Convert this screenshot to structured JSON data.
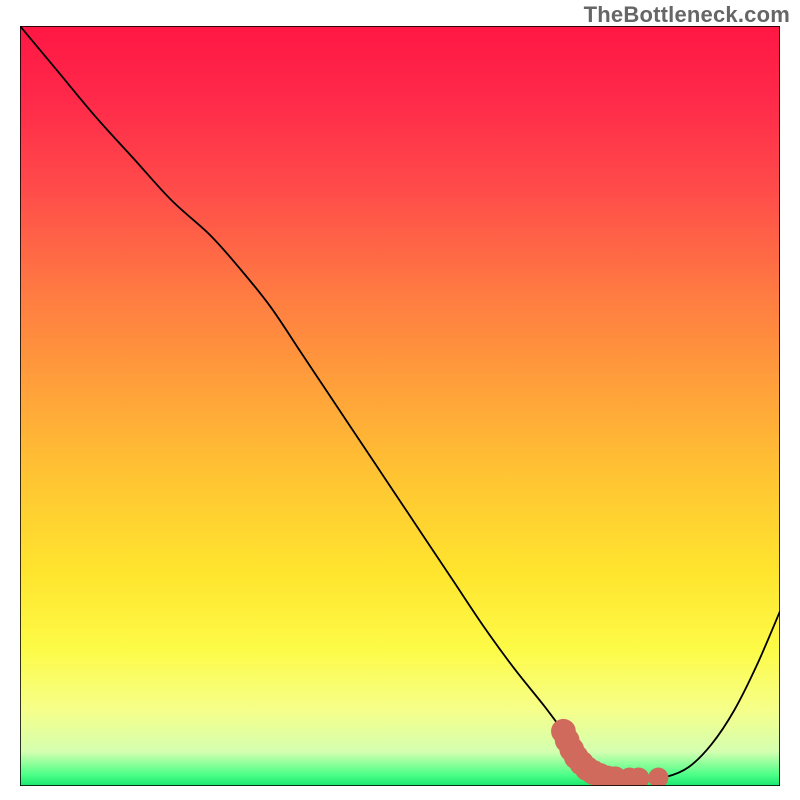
{
  "watermark": "TheBottleneck.com",
  "chart_data": {
    "type": "line",
    "title": "",
    "xlabel": "",
    "ylabel": "",
    "xlim": [
      0,
      100
    ],
    "ylim": [
      0,
      100
    ],
    "grid": false,
    "legend": false,
    "series": [
      {
        "name": "curve",
        "x": [
          0,
          5,
          10,
          15,
          20,
          25,
          29,
          33,
          37,
          41,
          45,
          49,
          53,
          57,
          61,
          65,
          69,
          72,
          74,
          76.5,
          79,
          82,
          85,
          88,
          91,
          94,
          97,
          100
        ],
        "y": [
          100,
          94,
          88,
          82.5,
          77,
          72.5,
          68,
          63,
          57,
          51,
          45,
          39,
          33,
          27,
          21,
          15.5,
          10.5,
          6.5,
          4,
          2.2,
          1.2,
          1.0,
          1.2,
          2.5,
          5.5,
          10,
          16,
          23
        ]
      }
    ],
    "markers": {
      "name": "highlight-dots",
      "color": "#d06a5c",
      "points": [
        {
          "x": 71.5,
          "y": 7.2,
          "r": 2.2
        },
        {
          "x": 72.0,
          "y": 6.0,
          "r": 2.2
        },
        {
          "x": 72.6,
          "y": 4.8,
          "r": 2.2
        },
        {
          "x": 73.2,
          "y": 3.8,
          "r": 2.2
        },
        {
          "x": 73.9,
          "y": 3.0,
          "r": 2.2
        },
        {
          "x": 74.6,
          "y": 2.3,
          "r": 2.2
        },
        {
          "x": 75.4,
          "y": 1.8,
          "r": 2.2
        },
        {
          "x": 76.3,
          "y": 1.4,
          "r": 2.2
        },
        {
          "x": 77.3,
          "y": 1.15,
          "r": 2.0
        },
        {
          "x": 78.3,
          "y": 1.05,
          "r": 2.0
        },
        {
          "x": 80.2,
          "y": 1.0,
          "r": 1.8
        },
        {
          "x": 81.4,
          "y": 1.0,
          "r": 1.8
        },
        {
          "x": 84.0,
          "y": 1.1,
          "r": 1.6
        }
      ]
    },
    "background_gradient": {
      "stops": [
        {
          "offset": 0.0,
          "color": "#ff1744"
        },
        {
          "offset": 0.1,
          "color": "#ff2a4a"
        },
        {
          "offset": 0.22,
          "color": "#ff4d4a"
        },
        {
          "offset": 0.35,
          "color": "#ff7a42"
        },
        {
          "offset": 0.48,
          "color": "#ffa23a"
        },
        {
          "offset": 0.6,
          "color": "#ffc632"
        },
        {
          "offset": 0.72,
          "color": "#ffe52e"
        },
        {
          "offset": 0.82,
          "color": "#fdfb47"
        },
        {
          "offset": 0.9,
          "color": "#f6ff8a"
        },
        {
          "offset": 0.955,
          "color": "#d4ffb0"
        },
        {
          "offset": 0.985,
          "color": "#4dff88"
        },
        {
          "offset": 1.0,
          "color": "#18e86e"
        }
      ]
    },
    "frame_color": "#000000"
  }
}
